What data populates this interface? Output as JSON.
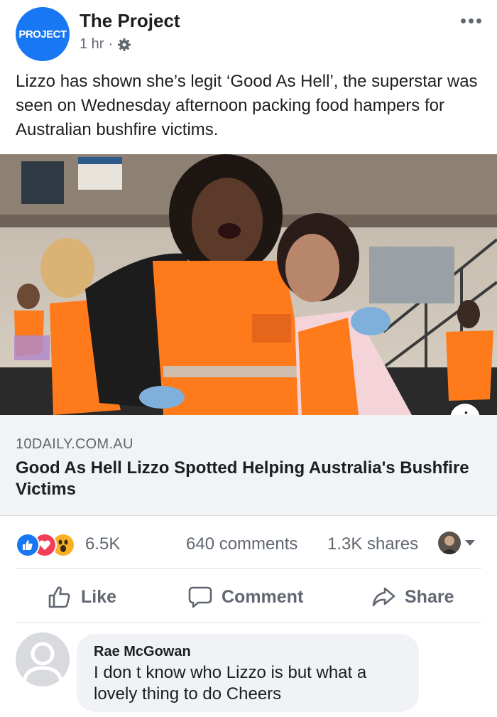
{
  "post": {
    "page_name": "The Project",
    "avatar_text": "PROJECT",
    "time": "1 hr",
    "separator": "·",
    "text": "Lizzo has shown she’s legit ‘Good As Hell’, the superstar was seen on Wednesday afternoon packing food hampers for Australian bushfire victims."
  },
  "link": {
    "domain": "10DAILY.COM.AU",
    "headline": "Good As Hell Lizzo Spotted Helping Australia's Bushfire Victims",
    "info_glyph": "i"
  },
  "stats": {
    "reactions": "6.5K",
    "comments": "640 comments",
    "shares": "1.3K shares",
    "reaction_types": [
      "like-icon",
      "love-icon",
      "wow-icon"
    ]
  },
  "actions": {
    "like": "Like",
    "comment": "Comment",
    "share": "Share"
  },
  "comment": {
    "author": "Rae McGowan",
    "text": "I don t know who Lizzo is but what a lovely thing to do Cheers"
  },
  "colors": {
    "brand_blue": "#1877f2",
    "vest_orange": "#ff7a1a",
    "text_secondary": "#606770"
  }
}
